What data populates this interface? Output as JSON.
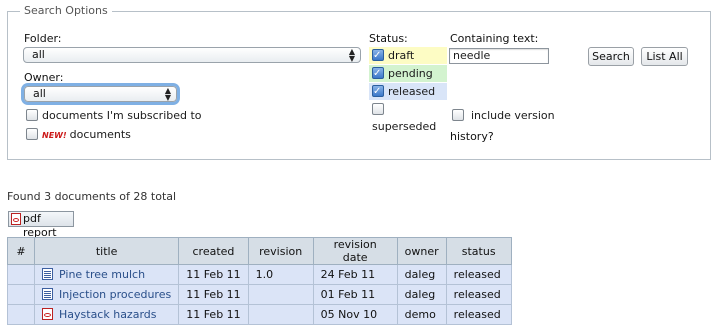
{
  "search_options": {
    "legend": "Search Options",
    "folder": {
      "label": "Folder:",
      "value": "all"
    },
    "owner": {
      "label": "Owner:",
      "value": "all"
    },
    "subscribed_label": "documents I'm subscribed to",
    "new_badge": "NEW!",
    "new_documents_label": "documents",
    "status": {
      "label": "Status:",
      "options": [
        {
          "label": "draft",
          "checked": true,
          "color": "#fdfcc4"
        },
        {
          "label": "pending",
          "checked": true,
          "color": "#d3f3cf"
        },
        {
          "label": "released",
          "checked": true,
          "color": "#d9e5f8"
        },
        {
          "label": "superseded",
          "checked": false,
          "color": "#ffffff"
        }
      ]
    },
    "containing_text": {
      "label": "Containing text:",
      "value": "needle"
    },
    "include_version_history": {
      "line1": "include version",
      "line2": "history?",
      "checked": false
    },
    "search_button": "Search",
    "list_all_button": "List All"
  },
  "results": {
    "summary": "Found 3 documents of 28 total",
    "pdf_report_button": "pdf report",
    "columns": [
      "#",
      "title",
      "created",
      "revision",
      "revision date",
      "owner",
      "status"
    ],
    "rows": [
      {
        "num": "",
        "icon": "doc-icon",
        "title": "Pine tree mulch",
        "created": "11 Feb 11",
        "revision": "1.0",
        "revision_date": "24 Feb 11",
        "owner": "daleg",
        "status": "released"
      },
      {
        "num": "",
        "icon": "doc-icon",
        "title": "Injection procedures",
        "created": "11 Feb 11",
        "revision": "",
        "revision_date": "01 Feb 11",
        "owner": "daleg",
        "status": "released"
      },
      {
        "num": "",
        "icon": "pdf-icon",
        "title": "Haystack hazards",
        "created": "11 Feb 11",
        "revision": "",
        "revision_date": "05 Nov 10",
        "owner": "demo",
        "status": "released"
      }
    ]
  },
  "colors": {
    "table_header_bg": "#d6dee6",
    "table_row_bg": "#dbe4f7",
    "link_color": "#2a4f8a",
    "focus_ring": "#7fb0e4"
  }
}
